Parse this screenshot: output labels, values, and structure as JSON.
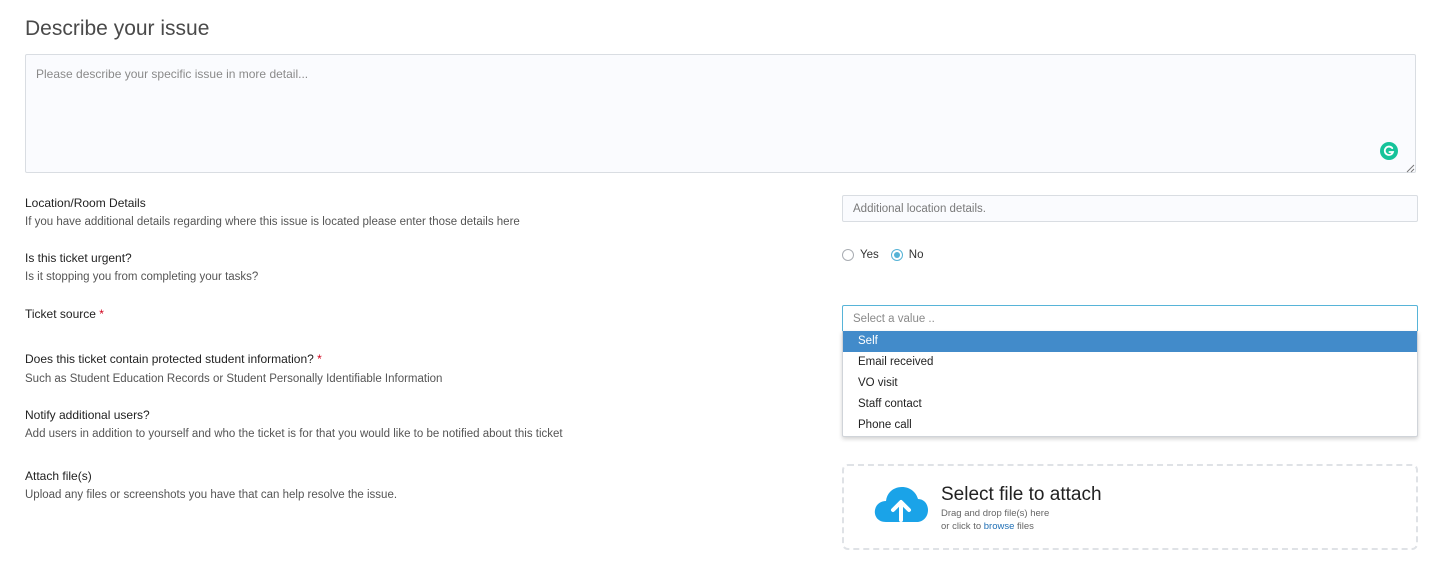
{
  "issue": {
    "heading": "Describe your issue",
    "placeholder": "Please describe your specific issue in more detail..."
  },
  "location": {
    "label": "Location/Room Details",
    "help": "If you have additional details regarding where this issue is located please enter those details here",
    "placeholder": "Additional location details."
  },
  "urgent": {
    "label": "Is this ticket urgent?",
    "help": "Is it stopping you from completing your tasks?",
    "options": [
      "Yes",
      "No"
    ],
    "selected": "No"
  },
  "ticket_source": {
    "label": "Ticket source",
    "required_mark": "*",
    "placeholder": "Select a value ..",
    "options": [
      "Self",
      "Email received",
      "VO visit",
      "Staff contact",
      "Phone call"
    ],
    "highlighted": "Self"
  },
  "protected_info": {
    "label": "Does this ticket contain protected student information?",
    "required_mark": "*",
    "help": "Such as Student Education Records or Student Personally Identifiable Information"
  },
  "notify": {
    "label": "Notify additional users?",
    "help": "Add users in addition to yourself and who the ticket is for that you would like to be notified about this ticket"
  },
  "attach": {
    "label": "Attach file(s)",
    "help": "Upload any files or screenshots you have that can help resolve the issue.",
    "drop_title": "Select file to attach",
    "drop_line1": "Drag and drop file(s) here",
    "drop_line2_prefix": "or click to",
    "drop_link": "browse",
    "drop_line2_suffix": "files"
  },
  "icons": {
    "grammarly": "grammarly-icon",
    "upload": "cloud-upload-icon"
  },
  "colors": {
    "accent": "#428bca",
    "focus_border": "#57b4d8",
    "radio_checked": "#55b3d6",
    "required": "#d0021b",
    "upload_icon": "#1aa3e8",
    "grammarly": "#15c39a",
    "link": "#1f6fb5"
  }
}
